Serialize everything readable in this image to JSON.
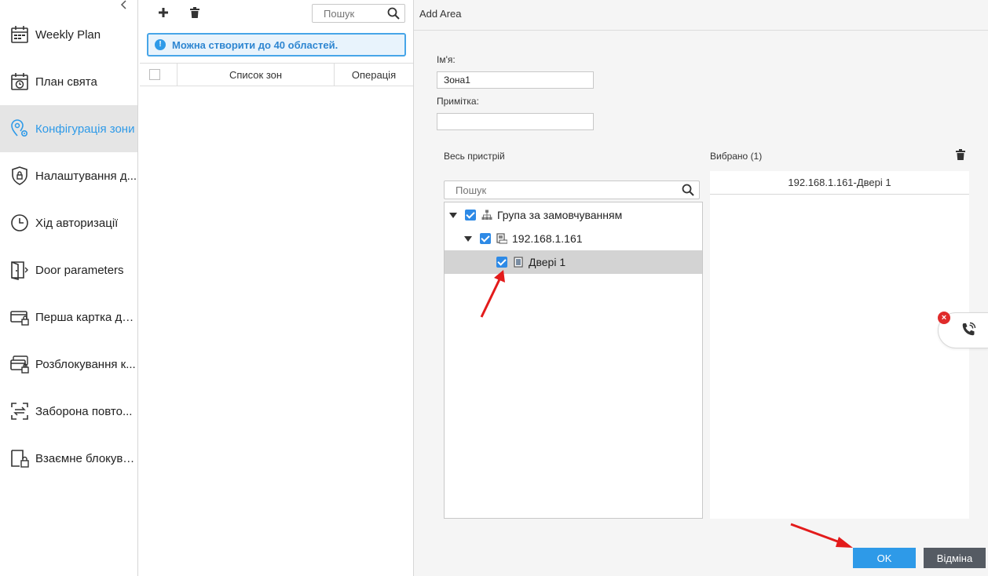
{
  "sidebar": {
    "collapse_icon": "chevron-left-icon",
    "items": [
      {
        "label": "Weekly Plan",
        "icon": "calendar-grid-icon"
      },
      {
        "label": "План свята",
        "icon": "calendar-clock-icon"
      },
      {
        "label": "Конфігурація зони",
        "icon": "location-gear-icon",
        "active": true
      },
      {
        "label": "Налаштування д...",
        "icon": "shield-icon"
      },
      {
        "label": "Хід авторизації",
        "icon": "clock-icon"
      },
      {
        "label": "Door parameters",
        "icon": "door-icon"
      },
      {
        "label": "Перша картка дл...",
        "icon": "card-lock-icon"
      },
      {
        "label": "Розблокування к...",
        "icon": "cards-lock-icon"
      },
      {
        "label": "Заборона повто...",
        "icon": "arrows-exchange-icon"
      },
      {
        "label": "Взаємне блокува...",
        "icon": "interlock-icon"
      }
    ]
  },
  "zone_panel": {
    "search_placeholder": "Пошук",
    "info_text": "Можна створити до 40 областей.",
    "columns": {
      "list": "Список зон",
      "operation": "Операція"
    }
  },
  "add_area": {
    "title": "Add Area",
    "name_label": "Ім'я:",
    "name_value": "Зона1",
    "note_label": "Примітка:",
    "note_value": "",
    "all_devices_label": "Весь пристрій",
    "selected_label": "Вибрано (1)",
    "tree_search_placeholder": "Пошук",
    "tree": {
      "group": "Група за замовчуванням",
      "device": "192.168.1.161",
      "door": "Двері 1"
    },
    "selected_items": [
      "192.168.1.161-Двері 1"
    ],
    "ok_label": "OK",
    "cancel_label": "Відміна"
  },
  "colors": {
    "accent": "#2e9ae8",
    "annotation_arrow": "#e31b1b",
    "cancel_button": "#555b63"
  }
}
